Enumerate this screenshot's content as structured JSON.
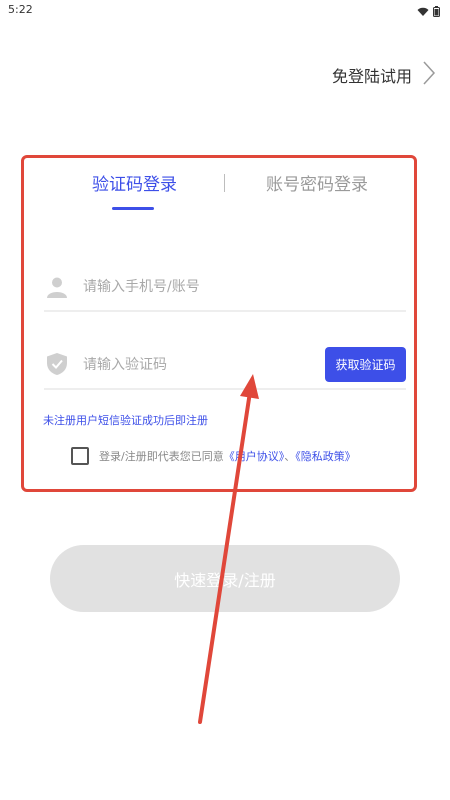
{
  "status_bar": {
    "time": "5:22",
    "icons": [
      "wifi-icon",
      "battery-icon"
    ]
  },
  "header": {
    "skip_label": "免登陆试用",
    "skip_icon": "chevron-right-icon"
  },
  "login_card": {
    "tabs": [
      {
        "label": "验证码登录",
        "active": true
      },
      {
        "label": "账号密码登录",
        "active": false
      }
    ],
    "phone_field": {
      "icon": "user-icon",
      "placeholder": "请输入手机号/账号",
      "value": ""
    },
    "code_field": {
      "icon": "shield-check-icon",
      "placeholder": "请输入验证码",
      "value": ""
    },
    "get_code_label": "获取验证码",
    "hint": "未注册用户短信验证成功后即注册",
    "agreement": {
      "checked": false,
      "prefix": "登录/注册即代表您已同意",
      "user_agreement": "《用户协议》",
      "separator": "、",
      "privacy_policy": "《隐私政策》"
    }
  },
  "login_button_label": "快速登录/注册",
  "colors": {
    "accent": "#3d4fe8",
    "annotation": "#e0473a",
    "disabled_button": "#e1e1e1"
  }
}
